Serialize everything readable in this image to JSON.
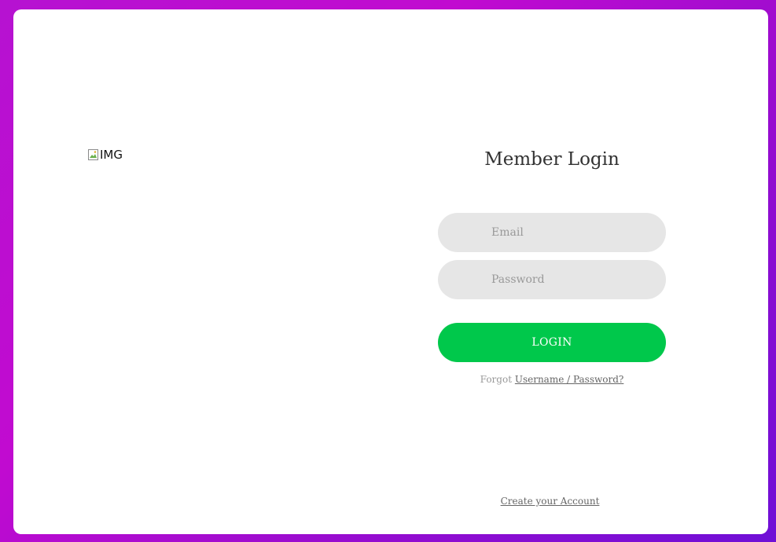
{
  "image": {
    "alt": "IMG",
    "icon": "broken-image-icon"
  },
  "login": {
    "title": "Member Login",
    "email_placeholder": "Email",
    "password_placeholder": "Password",
    "login_label": "LOGIN",
    "forgot_prefix": "Forgot",
    "forgot_link": "Username / Password?",
    "create_account": "Create your Account"
  },
  "colors": {
    "background_gradient": [
      "#b612d1",
      "#6f0fd6"
    ],
    "login_button": "#00c84b",
    "field_background": "#e6e6e6"
  }
}
